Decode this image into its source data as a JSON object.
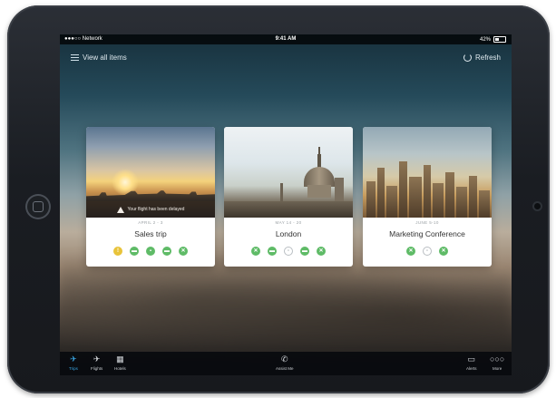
{
  "status_bar": {
    "carrier": "●●●○○ Network",
    "time": "9:41 AM",
    "battery": "42%"
  },
  "topbar": {
    "view_all_label": "View all items",
    "refresh_label": "Refresh"
  },
  "cards": [
    {
      "title": "Sales trip",
      "dates": "APRIL 2 - 3",
      "banner": "Your flight has been delayed",
      "icons": [
        "yellow",
        "green",
        "green",
        "green",
        "green"
      ]
    },
    {
      "title": "London",
      "dates": "MAY 14 - 20",
      "icons": [
        "green",
        "green",
        "gray",
        "green",
        "green"
      ]
    },
    {
      "title": "Marketing Conference",
      "dates": "JUNE 5-10",
      "icons": [
        "green",
        "gray",
        "green"
      ]
    }
  ],
  "tabbar": {
    "trips": "Trips",
    "flights": "Flights",
    "hotels": "Hotels",
    "assist": "Assist Me",
    "alerts": "Alerts",
    "more": "More",
    "active_color": "#3aa6e4"
  },
  "colors": {
    "status_green": "#5fbb67",
    "status_yellow": "#e8c33a"
  }
}
